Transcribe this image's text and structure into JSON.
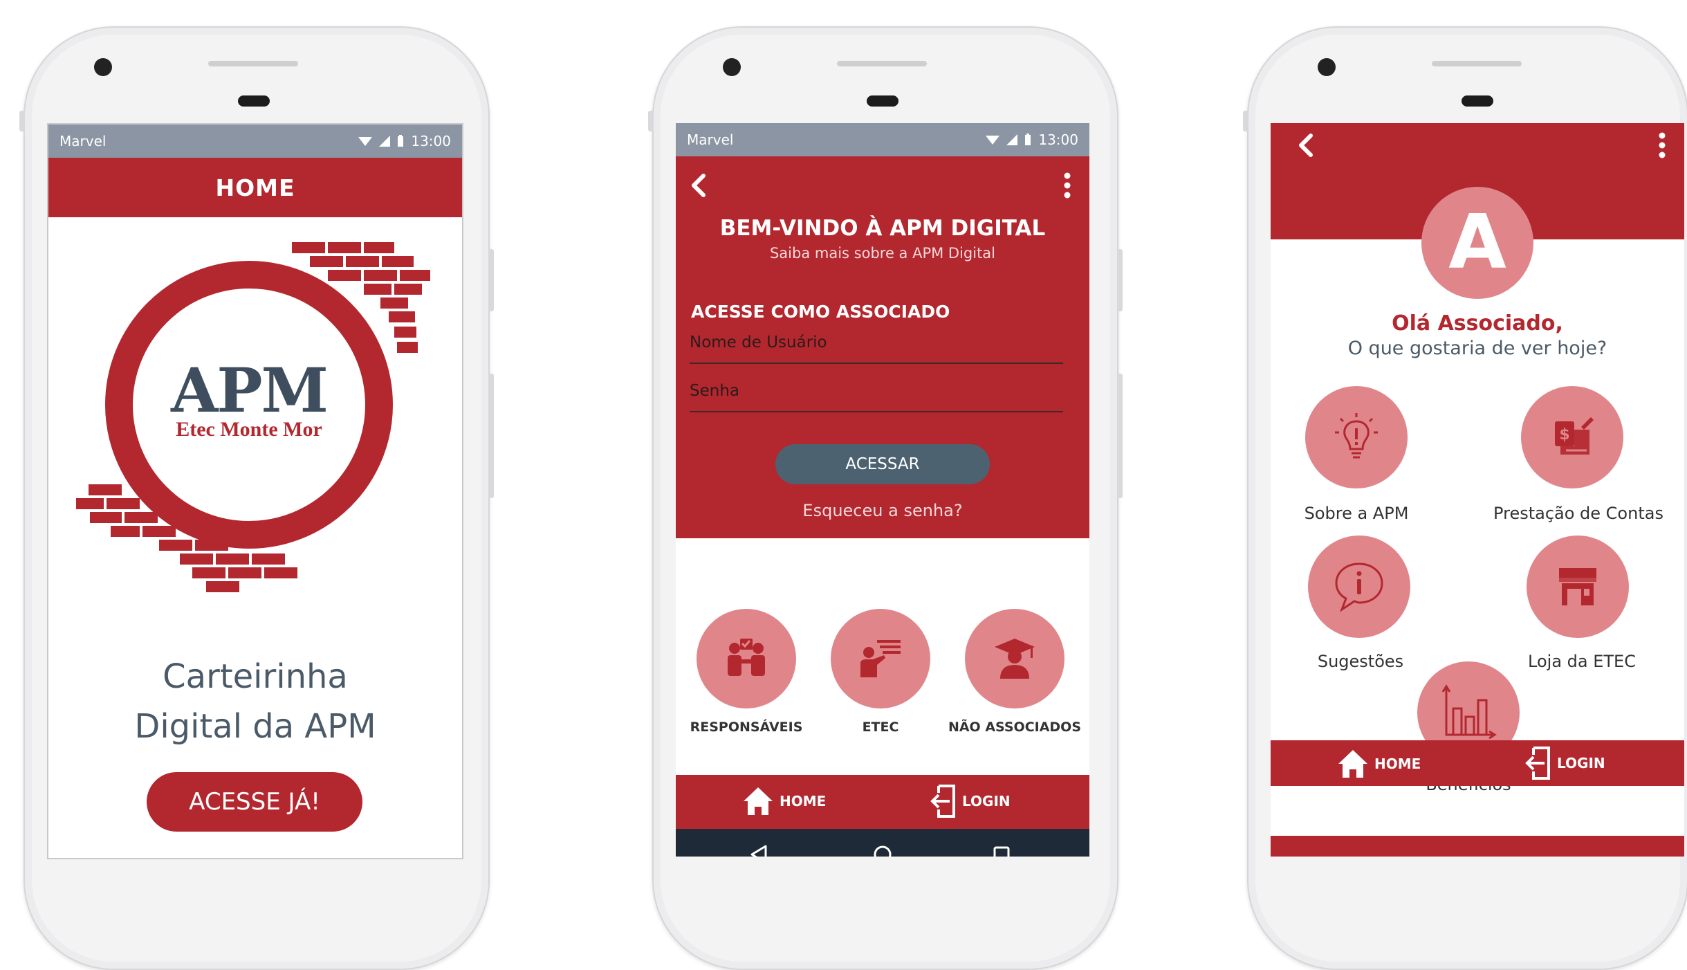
{
  "phones": [
    {
      "status": {
        "carrier": "Marvel",
        "time": "13:00"
      },
      "header": {
        "title": "HOME"
      },
      "logo": {
        "main": "APM",
        "sub": "Etec Monte Mor"
      },
      "headline": [
        "Carteirinha",
        "Digital da APM"
      ],
      "cta": "ACESSE JÁ!"
    },
    {
      "status": {
        "carrier": "Marvel",
        "time": "13:00"
      },
      "welcome": {
        "title": "BEM-VINDO À APM DIGITAL",
        "subtitle": "Saiba mais sobre a APM Digital"
      },
      "login": {
        "section": "ACESSE COMO ASSOCIADO",
        "username_placeholder": "Nome de Usuário",
        "password_placeholder": "Senha",
        "button": "ACESSAR",
        "forgot": "Esqueceu a senha?"
      },
      "categories": [
        {
          "label": "RESPONSÁVEIS",
          "icon": "parents-icon"
        },
        {
          "label": "ETEC",
          "icon": "teacher-icon"
        },
        {
          "label": "NÃO ASSOCIADOS",
          "icon": "graduate-icon"
        }
      ],
      "bottomnav": {
        "home": "HOME",
        "login": "LOGIN"
      }
    },
    {
      "avatar": "A",
      "greeting": "Olá Associado,",
      "question": "O que gostaria de ver hoje?",
      "menu": [
        {
          "label": "Sobre a APM",
          "icon": "lightbulb-icon"
        },
        {
          "label": "Prestação de Contas",
          "icon": "invoice-icon"
        },
        {
          "label": "Sugestões",
          "icon": "speech-bubble-icon"
        },
        {
          "label": "Loja da ETEC",
          "icon": "store-icon"
        },
        {
          "label": "Benefícios",
          "icon": "bar-chart-icon"
        }
      ],
      "bottomnav": {
        "home": "HOME",
        "login": "LOGIN"
      }
    }
  ],
  "colors": {
    "primary": "#b3272f",
    "accent": "#e0868b",
    "button": "#4d6271",
    "text": "#4a5a68"
  }
}
